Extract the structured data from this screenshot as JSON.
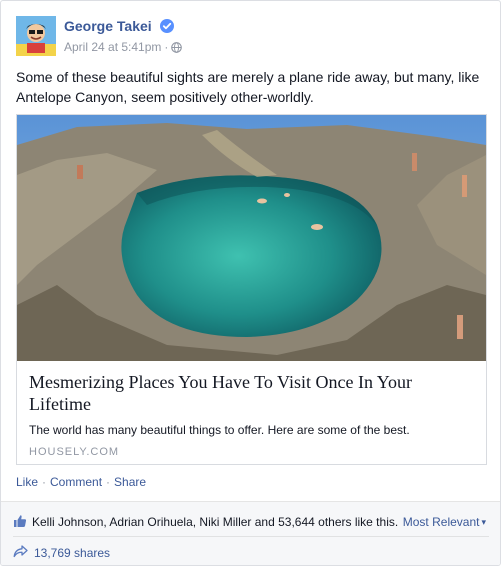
{
  "post": {
    "author": "George Takei",
    "timestamp": "April 24 at 5:41pm",
    "separator": "·",
    "text": "Some of these beautiful sights are merely a plane ride away, but many, like Antelope Canyon, seem positively other-worldly.",
    "icons": {
      "verified": "verified-badge-icon",
      "audience": "globe-icon"
    }
  },
  "link": {
    "title": "Mesmerizing Places You Have To Visit Once In Your Lifetime",
    "description": "The world has many beautiful things to offer. Here are some of the best.",
    "domain": "HOUSELY.COM"
  },
  "actions": {
    "like": "Like",
    "comment": "Comment",
    "share": "Share",
    "separator": "·"
  },
  "feedback": {
    "likes_text": "Kelli Johnson, Adrian Orihuela, Niki Miller and 53,644 others like this.",
    "sort_label": "Most Relevant",
    "sort_arrow": "▾",
    "shares_text": "13,769 shares"
  },
  "colors": {
    "link_blue": "#3b5998",
    "muted_gray": "#9197a3",
    "feedback_bg": "#f6f7f9",
    "pool_teal": "#1f8f8a"
  }
}
